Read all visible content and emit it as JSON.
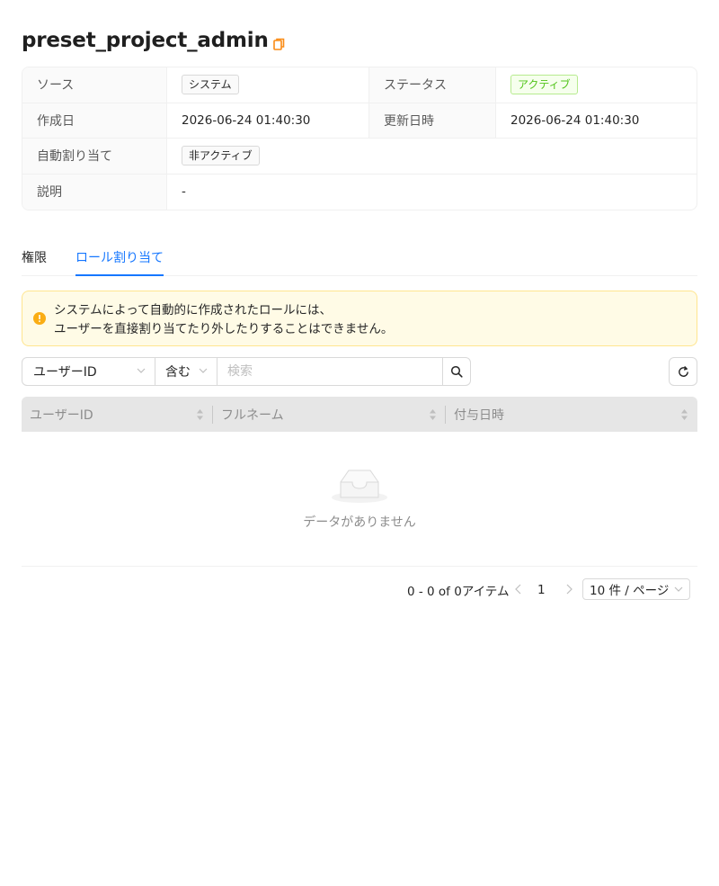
{
  "page": {
    "title": "preset_project_admin"
  },
  "details": {
    "source_label": "ソース",
    "source_value": "システム",
    "status_label": "ステータス",
    "status_value": "アクティブ",
    "created_label": "作成日",
    "created_value": "2026-06-24 01:40:30",
    "updated_label": "更新日時",
    "updated_value": "2026-06-24 01:40:30",
    "auto_assign_label": "自動割り当て",
    "auto_assign_value": "非アクティブ",
    "description_label": "説明",
    "description_value": "-"
  },
  "tabs": [
    {
      "label": "権限",
      "active": false
    },
    {
      "label": "ロール割り当て",
      "active": true
    }
  ],
  "alert": {
    "line1": "システムによって自動的に作成されたロールには、",
    "line2": "ユーザーを直接割り当てたり外したりすることはできません。"
  },
  "filter": {
    "field_value": "ユーザーID",
    "operator_value": "含む",
    "search_placeholder": "検索"
  },
  "table": {
    "columns": [
      "ユーザーID",
      "フルネーム",
      "付与日時"
    ],
    "rows": [],
    "empty_text": "データがありません"
  },
  "pagination": {
    "total_text": "0 - 0 of 0アイテム",
    "current_page": "1",
    "page_size": "10 件 / ページ"
  },
  "colors": {
    "accent": "#1677ff",
    "active_tag": "#52c41a",
    "warning": "#faad14",
    "copy_icon": "#fa8c16"
  }
}
